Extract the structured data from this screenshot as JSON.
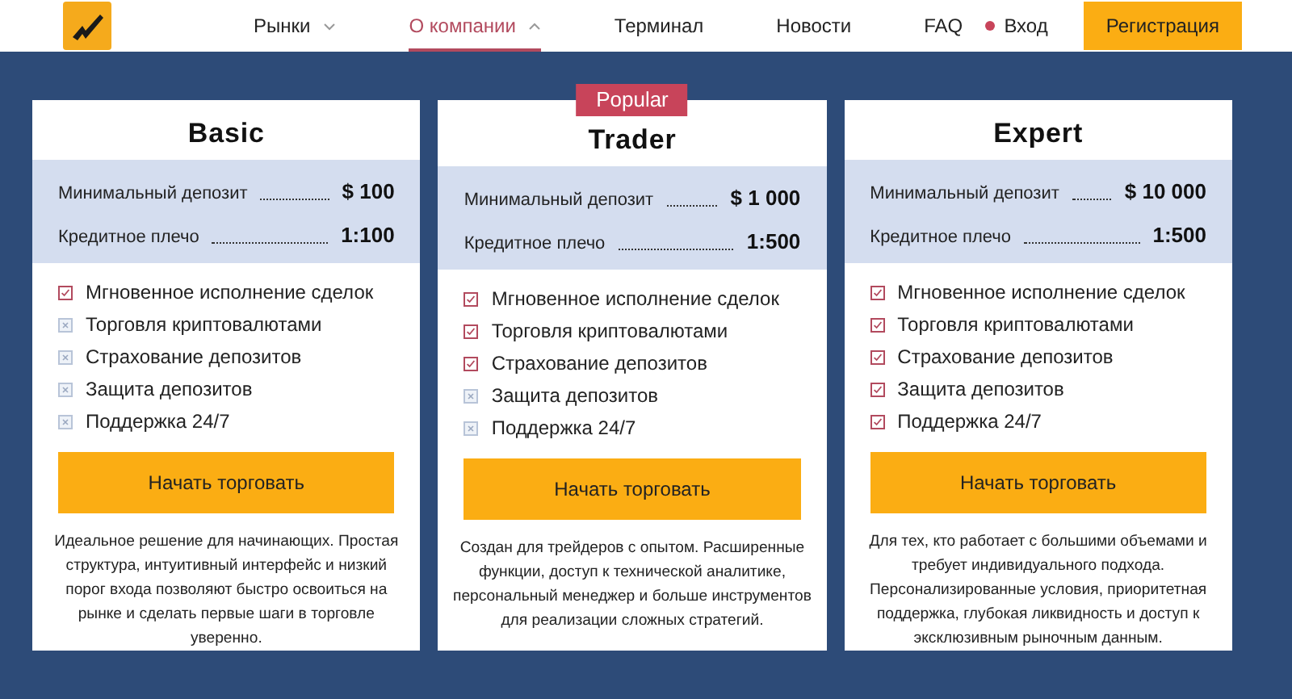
{
  "nav": {
    "items": [
      {
        "label": "Рынки",
        "selected": false,
        "has_menu": true,
        "expanded": false
      },
      {
        "label": "О компании",
        "selected": true,
        "has_menu": true,
        "expanded": true
      },
      {
        "label": "Терминал",
        "selected": false,
        "has_menu": false
      },
      {
        "label": "Новости",
        "selected": false,
        "has_menu": false
      },
      {
        "label": "FAQ",
        "selected": false,
        "has_menu": false
      }
    ],
    "login": "Вход",
    "register": "Регистрация"
  },
  "plans": [
    {
      "name": "Basic",
      "stats": [
        {
          "label": "Минимальный депозит",
          "value": "$ 100"
        },
        {
          "label": "Кредитное плечо",
          "value": "1:100"
        }
      ],
      "features": [
        {
          "label": "Мгновенное исполнение сделок",
          "checked": true
        },
        {
          "label": "Торговля криптовалютами",
          "checked": false
        },
        {
          "label": "Страхование депозитов",
          "checked": false
        },
        {
          "label": "Защита депозитов",
          "checked": false
        },
        {
          "label": "Поддержка 24/7",
          "checked": false
        }
      ],
      "button": "Начать торговать",
      "description": "Идеальное решение для начинающих. Простая структура, интуитивный интерфейс и низкий порог входа позволяют быстро освоиться на рынке и сделать первые шаги в торговле уверенно."
    },
    {
      "name": "Trader",
      "badge": "Popular",
      "stats": [
        {
          "label": "Минимальный депозит",
          "value": "$ 1 000"
        },
        {
          "label": "Кредитное плечо",
          "value": "1:500"
        }
      ],
      "features": [
        {
          "label": "Мгновенное исполнение сделок",
          "checked": true
        },
        {
          "label": "Торговля криптовалютами",
          "checked": true
        },
        {
          "label": "Страхование депозитов",
          "checked": true
        },
        {
          "label": "Защита депозитов",
          "checked": false
        },
        {
          "label": "Поддержка 24/7",
          "checked": false
        }
      ],
      "button": "Начать торговать",
      "description": "Создан для трейдеров с опытом. Расширенные функции, доступ к технической аналитике, персональный менеджер и больше инструментов для реализации сложных стратегий."
    },
    {
      "name": "Expert",
      "stats": [
        {
          "label": "Минимальный депозит",
          "value": "$ 10 000"
        },
        {
          "label": "Кредитное плечо",
          "value": "1:500"
        }
      ],
      "features": [
        {
          "label": "Мгновенное исполнение сделок",
          "checked": true
        },
        {
          "label": "Торговля криптовалютами",
          "checked": true
        },
        {
          "label": "Страхование депозитов",
          "checked": true
        },
        {
          "label": "Защита депозитов",
          "checked": true
        },
        {
          "label": "Поддержка 24/7",
          "checked": true
        }
      ],
      "button": "Начать торговать",
      "description": "Для тех, кто работает с большими объемами и требует индивидуального подхода. Персонализированные условия, приоритетная поддержка, глубокая ликвидность и доступ к эксклюзивным рыночным данным."
    }
  ]
}
